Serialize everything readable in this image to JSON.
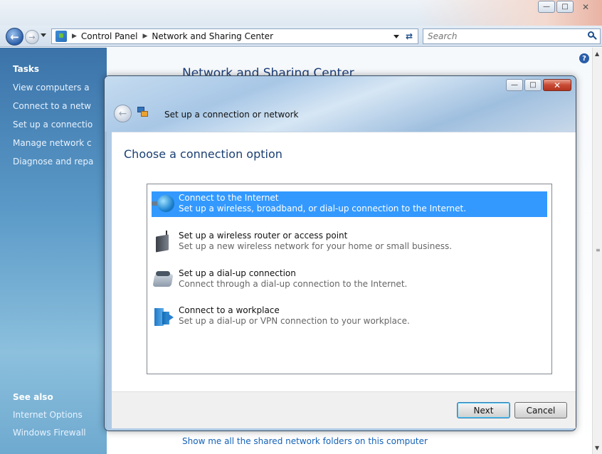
{
  "window": {
    "minimize_icon": "minimize-icon",
    "maximize_icon": "maximize-icon",
    "close_icon": "close-icon"
  },
  "address_bar": {
    "crumbs": [
      "Control Panel",
      "Network and Sharing Center"
    ],
    "search_placeholder": "Search"
  },
  "left_pane": {
    "tasks_title": "Tasks",
    "tasks": [
      "View computers a",
      "Connect to a netw",
      "Set up a connectio",
      "Manage network c",
      "Diagnose and repa"
    ],
    "see_also_title": "See also",
    "see_also": [
      "Internet Options",
      "Windows Firewall"
    ]
  },
  "main": {
    "title": "Network and Sharing Center",
    "bottom_link": "Show me all the shared network folders on this computer"
  },
  "dialog": {
    "title": "Set up a connection or network",
    "heading": "Choose a connection option",
    "options": [
      {
        "title": "Connect to the Internet",
        "description": "Set up a wireless, broadband, or dial-up connection to the Internet.",
        "icon": "globe-icon",
        "selected": true
      },
      {
        "title": "Set up a wireless router or access point",
        "description": "Set up a new wireless network for your home or small business.",
        "icon": "router-icon",
        "selected": false
      },
      {
        "title": "Set up a dial-up connection",
        "description": "Connect through a dial-up connection to the Internet.",
        "icon": "phone-icon",
        "selected": false
      },
      {
        "title": "Connect to a workplace",
        "description": "Set up a dial-up or VPN connection to your workplace.",
        "icon": "workplace-icon",
        "selected": false
      }
    ],
    "next_label": "Next",
    "cancel_label": "Cancel"
  },
  "colors": {
    "selection": "#3399ff",
    "heading": "#1a3f73",
    "link": "#1462b8"
  }
}
